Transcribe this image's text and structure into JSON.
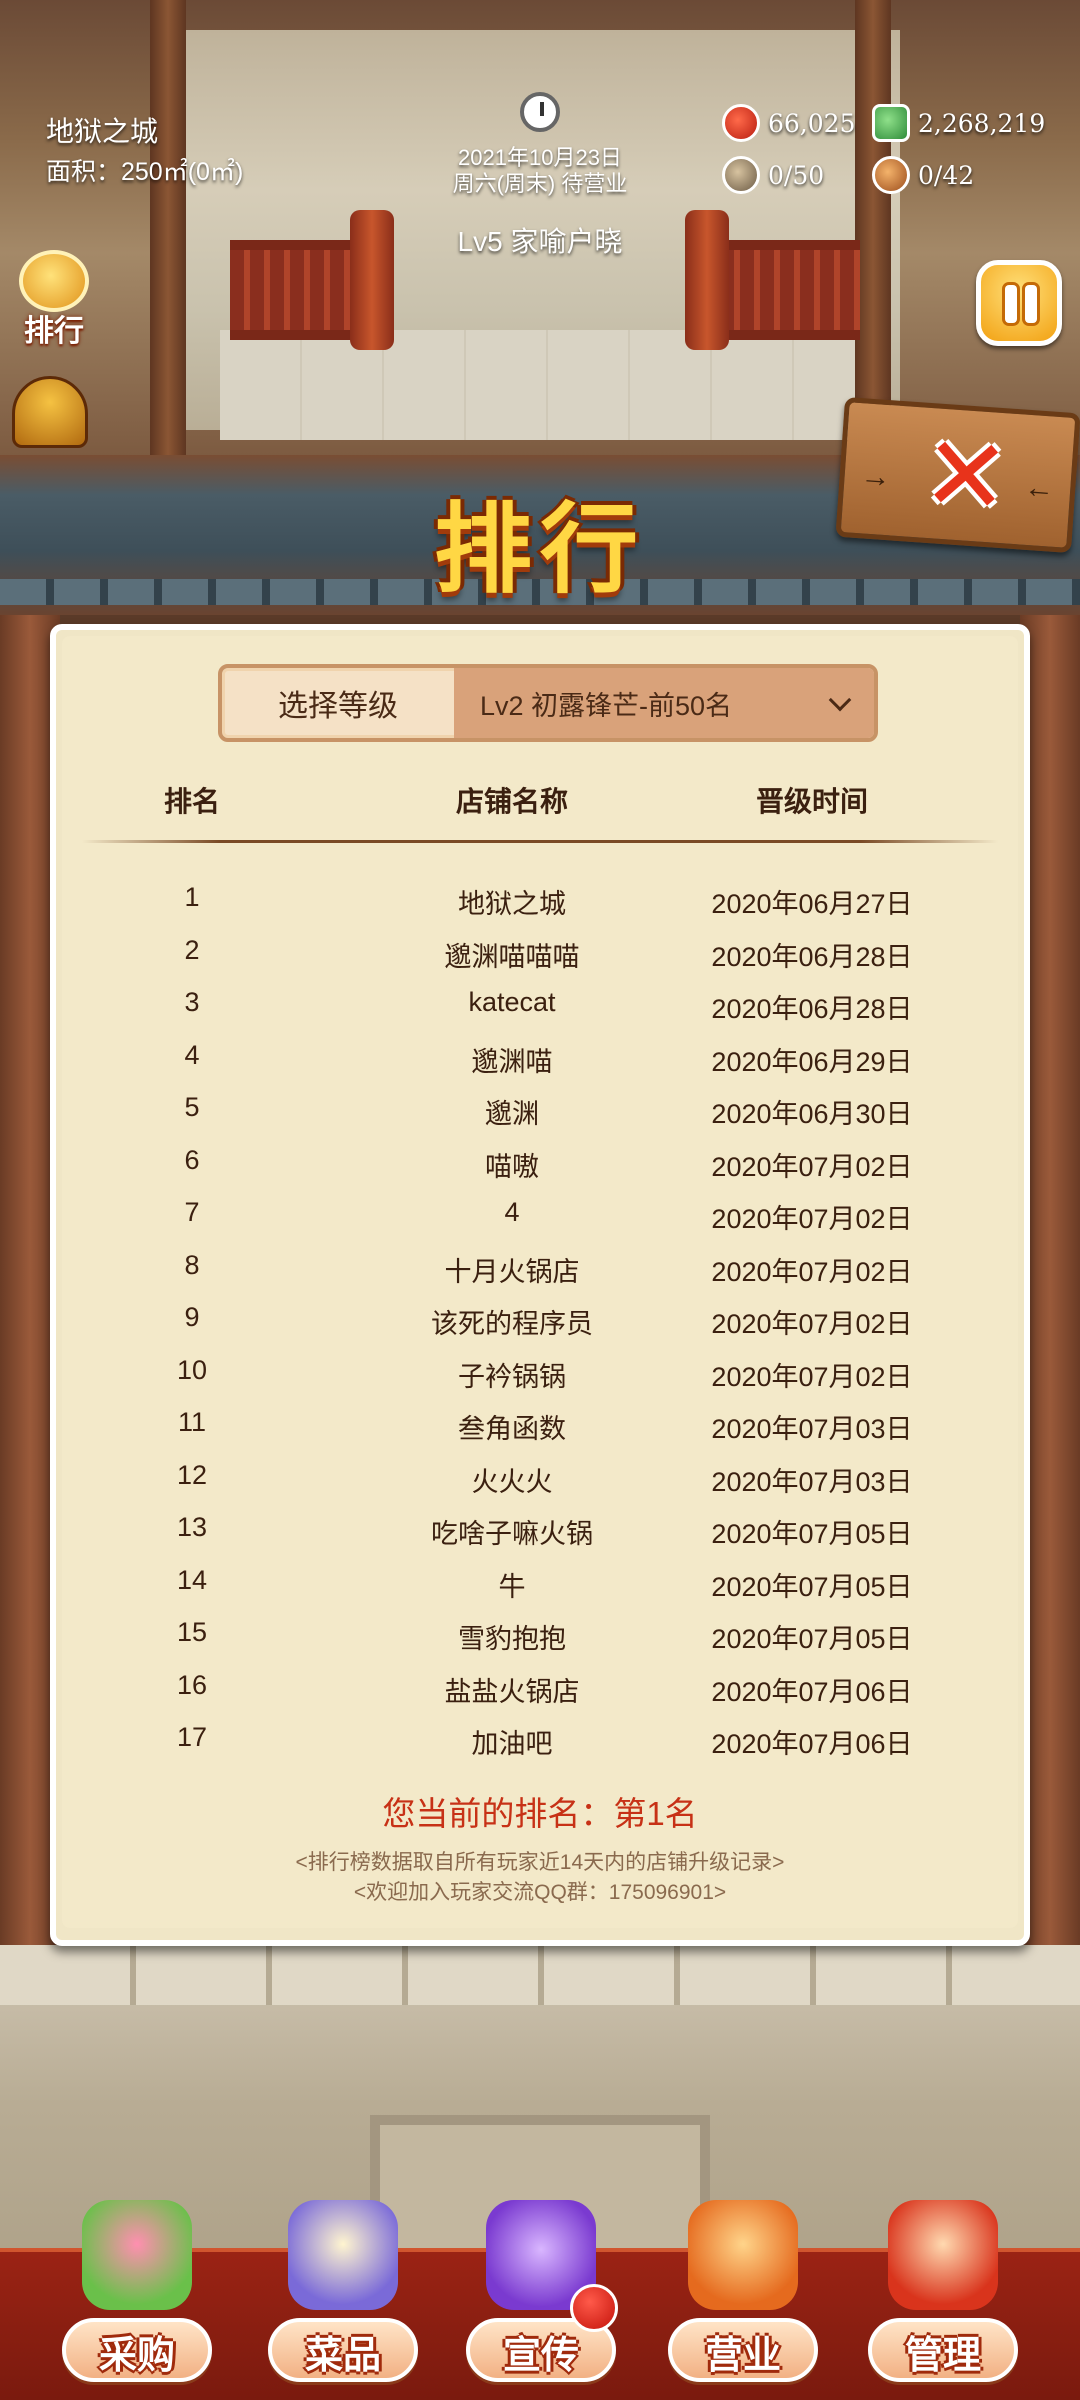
{
  "hud": {
    "shop_name": "地狱之城",
    "shop_area": "面积：250㎡(0㎡)",
    "date": "2021年10月23日",
    "weekday_status": "周六(周末) 待营业",
    "level_title": "Lv5 家喻户晓",
    "resources": [
      "66,025",
      "2,268,219",
      "0/50",
      "0/42"
    ],
    "rank_badge_label": "排行",
    "icons": [
      "clock-icon",
      "tomato-icon",
      "cash-icon",
      "worker-icon",
      "customer-icon",
      "medal-icon",
      "money-pot-icon",
      "pause-icon"
    ]
  },
  "panel": {
    "title": "排行",
    "selector_label": "选择等级",
    "selector_value": "Lv2 初露锋芒-前50名",
    "columns": [
      "排名",
      "店铺名称",
      "晋级时间"
    ],
    "rows": [
      {
        "rank": "1",
        "name": "地狱之城",
        "time": "2020年06月27日"
      },
      {
        "rank": "2",
        "name": "邈渊喵喵喵",
        "time": "2020年06月28日"
      },
      {
        "rank": "3",
        "name": "katecat",
        "time": "2020年06月28日"
      },
      {
        "rank": "4",
        "name": "邈渊喵",
        "time": "2020年06月29日"
      },
      {
        "rank": "5",
        "name": "邈渊",
        "time": "2020年06月30日"
      },
      {
        "rank": "6",
        "name": "喵嗷",
        "time": "2020年07月02日"
      },
      {
        "rank": "7",
        "name": "4",
        "time": "2020年07月02日"
      },
      {
        "rank": "8",
        "name": "十月火锅店",
        "time": "2020年07月02日"
      },
      {
        "rank": "9",
        "name": "该死的程序员",
        "time": "2020年07月02日"
      },
      {
        "rank": "10",
        "name": "子衿锅锅",
        "time": "2020年07月02日"
      },
      {
        "rank": "11",
        "name": "叁角函数",
        "time": "2020年07月03日"
      },
      {
        "rank": "12",
        "name": "火火火",
        "time": "2020年07月03日"
      },
      {
        "rank": "13",
        "name": "吃啥子嘛火锅",
        "time": "2020年07月05日"
      },
      {
        "rank": "14",
        "name": "牛",
        "time": "2020年07月05日"
      },
      {
        "rank": "15",
        "name": "雪豹抱抱",
        "time": "2020年07月05日"
      },
      {
        "rank": "16",
        "name": "盐盐火锅店",
        "time": "2020年07月06日"
      },
      {
        "rank": "17",
        "name": "加油吧",
        "time": "2020年07月06日"
      }
    ],
    "my_rank": "您当前的排名：第1名",
    "note1": "<排行榜数据取自所有玩家近14天内的店铺升级记录>",
    "note2": "<欢迎加入玩家交流QQ群：175096901>"
  },
  "nav": [
    "采购",
    "菜品",
    "宣传",
    "营业",
    "管理"
  ],
  "colors": {
    "title_gold": "#ffd744",
    "panel_bg": "#f3e9c9",
    "my_rank_red": "#c73116",
    "nav_bar_red": "#9b2314"
  }
}
